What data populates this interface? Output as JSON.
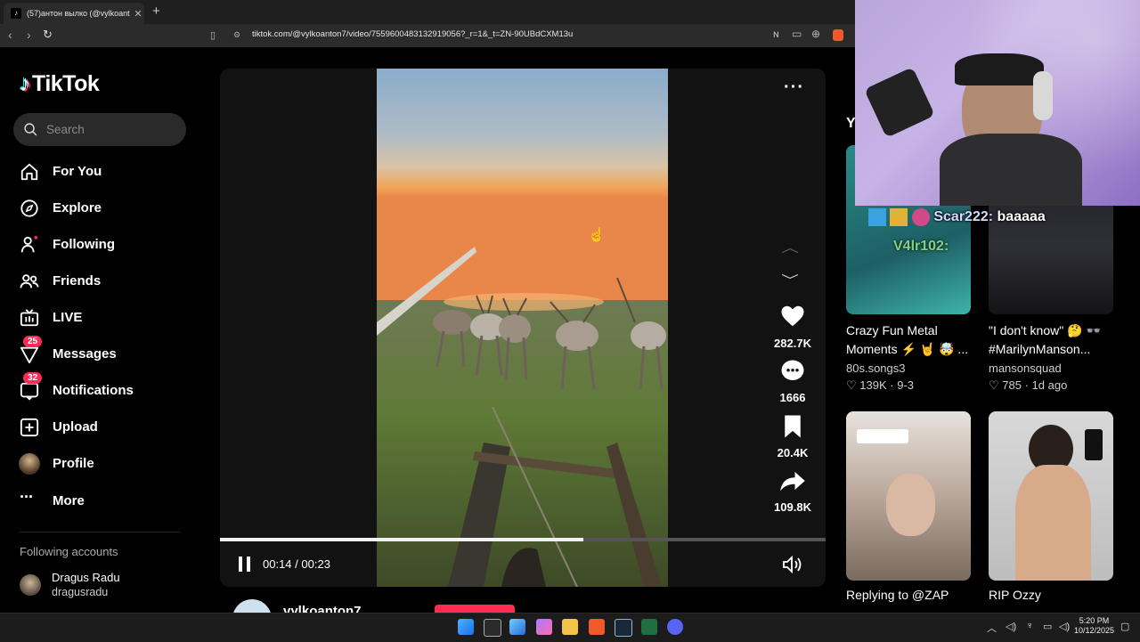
{
  "browser": {
    "tab_title": "(57)антон вылко (@vylkoant",
    "tab_favicon": "tiktok-icon",
    "url": "tiktok.com/@vylkoanton7/video/7559600483132919056?_r=1&_t=ZN-90UBdCXM13u"
  },
  "sidebar": {
    "logo": "TikTok",
    "search_placeholder": "Search",
    "items": [
      {
        "label": "For You",
        "icon": "home-icon"
      },
      {
        "label": "Explore",
        "icon": "compass-icon"
      },
      {
        "label": "Following",
        "icon": "following-icon"
      },
      {
        "label": "Friends",
        "icon": "friends-icon"
      },
      {
        "label": "LIVE",
        "icon": "live-tv-icon"
      },
      {
        "label": "Messages",
        "icon": "messages-icon",
        "badge": "25"
      },
      {
        "label": "Notifications",
        "icon": "notifications-icon",
        "badge": "32"
      },
      {
        "label": "Upload",
        "icon": "upload-icon"
      },
      {
        "label": "Profile",
        "icon": "profile-avatar"
      },
      {
        "label": "More",
        "icon": "more-icon"
      }
    ],
    "following_header": "Following accounts",
    "following_accounts": [
      {
        "name": "Dragus Radu",
        "username": "dragusradu"
      }
    ]
  },
  "video": {
    "time_current": "00:14",
    "time_total": "00:23",
    "progress": 0.6,
    "likes": "282.7K",
    "comments": "1666",
    "saves": "20.4K",
    "shares": "109.8K",
    "author": "vylkoanton7"
  },
  "right_column": {
    "header": "Y",
    "cards": [
      {
        "title": "Crazy Fun Metal Moments ⚡ 🤘 🤯 ...",
        "author": "80s.songs3",
        "likes": "139K",
        "date": "9-3"
      },
      {
        "title": "\"I don't know\" 🤔 👓 #MarilynManson...",
        "author": "mansonsquad",
        "likes": "785",
        "date": "1d ago"
      },
      {
        "title": "Replying to @ZAP",
        "author": "",
        "likes": "",
        "date": ""
      },
      {
        "title": "RIP Ozzy",
        "author": "",
        "likes": "",
        "date": ""
      }
    ]
  },
  "stream_overlay": {
    "chat_user": "Scar222:",
    "chat_message": "baaaaa",
    "chat_user2": "V4lr102:"
  },
  "taskbar": {
    "time": "5:20 PM",
    "date": "10/12/2025"
  },
  "colors": {
    "accent": "#fe2c55",
    "background": "#000000",
    "surface": "#2a2a2a"
  }
}
